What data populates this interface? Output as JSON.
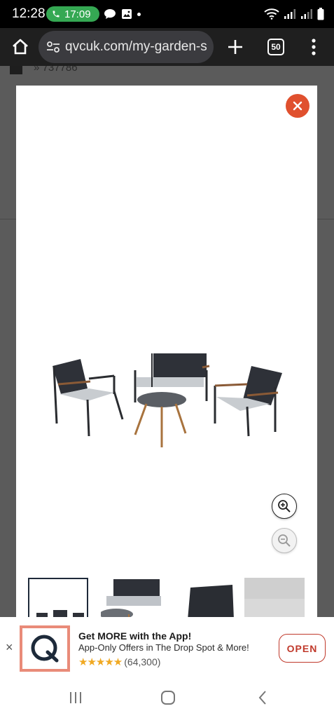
{
  "status_bar": {
    "time": "12:28",
    "call_timer": "17:09",
    "icons": [
      "phone-icon",
      "chat-bubble-icon",
      "image-icon",
      "dot-icon",
      "wifi-icon",
      "signal-icon",
      "signal-icon-2",
      "battery-icon"
    ]
  },
  "browser": {
    "url": "qvcuk.com/my-garden-s",
    "tab_count": "50",
    "icons": [
      "home-icon",
      "site-settings-icon",
      "plus-icon",
      "more-vert-icon"
    ]
  },
  "background_page": {
    "breadcrumb": "» 737786"
  },
  "modal": {
    "close_icon": "close-icon",
    "zoom_in_icon": "zoom-in-icon",
    "zoom_out_icon": "zoom-out-icon",
    "thumbnails": [
      "thumbnail-1",
      "thumbnail-2",
      "thumbnail-3",
      "thumbnail-4"
    ]
  },
  "app_banner": {
    "close": "×",
    "title": "Get MORE with the App!",
    "subtitle": "App-Only Offers in The Drop Spot & More!",
    "stars": "★★★★★",
    "rating_count": "(64,300)",
    "open_label": "OPEN",
    "colors": {
      "accent": "#c0392b",
      "star": "#f0a922"
    }
  },
  "nav_bar": {
    "icons": [
      "recents-icon",
      "home-nav-icon",
      "back-icon"
    ]
  }
}
